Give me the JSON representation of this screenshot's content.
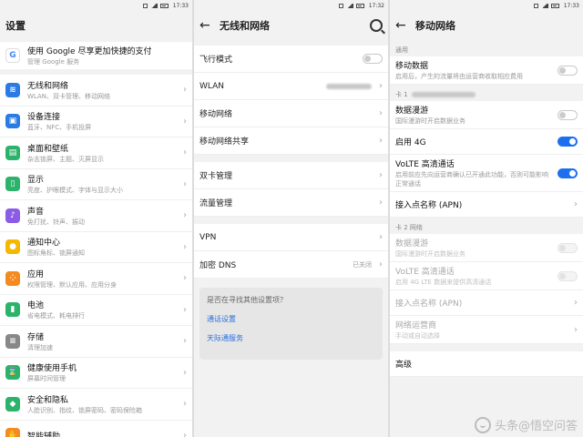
{
  "statusbar": [
    {
      "time": "17:33"
    },
    {
      "time": "17:32"
    },
    {
      "time": "17:33"
    }
  ],
  "settings": {
    "title": "设置",
    "google": {
      "title": "使用 Google 尽享更加快捷的支付",
      "subtitle": "管理 Google 服务"
    },
    "items": [
      {
        "title": "无线和网络",
        "subtitle": "WLAN、双卡管理、移动网络",
        "icon": "wifi-icon",
        "color": "#2b7be5"
      },
      {
        "title": "设备连接",
        "subtitle": "蓝牙、NFC、手机投屏",
        "icon": "device-connect-icon",
        "color": "#2b7be5"
      },
      {
        "title": "桌面和壁纸",
        "subtitle": "杂志锁屏、主题、灭屏显示",
        "icon": "wallpaper-icon",
        "color": "#2cb36b"
      },
      {
        "title": "显示",
        "subtitle": "亮度、护眼模式、字体与显示大小",
        "icon": "display-icon",
        "color": "#2cb36b"
      },
      {
        "title": "声音",
        "subtitle": "免打扰、铃声、振动",
        "icon": "sound-icon",
        "color": "#8b5ce6"
      },
      {
        "title": "通知中心",
        "subtitle": "图标角标、锁屏通知",
        "icon": "notification-icon",
        "color": "#f5b700"
      },
      {
        "title": "应用",
        "subtitle": "权限管理、默认应用、应用分身",
        "icon": "apps-icon",
        "color": "#f58a1f"
      },
      {
        "title": "电池",
        "subtitle": "省电模式、耗电排行",
        "icon": "battery-icon",
        "color": "#2cb36b"
      },
      {
        "title": "存储",
        "subtitle": "清理加速",
        "icon": "storage-icon",
        "color": "#888888"
      },
      {
        "title": "健康使用手机",
        "subtitle": "屏幕时间管理",
        "icon": "health-icon",
        "color": "#2cb36b"
      },
      {
        "title": "安全和隐私",
        "subtitle": "人脸识别、指纹、锁屏密码、密码保险箱",
        "icon": "shield-icon",
        "color": "#2cb36b"
      },
      {
        "title": "智能辅助",
        "subtitle": "",
        "icon": "assist-icon",
        "color": "#f58a1f"
      }
    ]
  },
  "wireless": {
    "title": "无线和网络",
    "group1": [
      {
        "label": "飞行模式"
      },
      {
        "label": "WLAN"
      },
      {
        "label": "移动网络"
      },
      {
        "label": "移动网络共享"
      }
    ],
    "group2": [
      {
        "label": "双卡管理"
      },
      {
        "label": "流量管理"
      }
    ],
    "group3": [
      {
        "label": "VPN"
      },
      {
        "label": "加密 DNS",
        "value": "已关闭"
      }
    ],
    "tips": {
      "question": "是否在寻找其他设置项？",
      "links": [
        "通话设置",
        "天际通服务"
      ]
    }
  },
  "mobile": {
    "title": "移动网络",
    "section_general": "通用",
    "mobile_data": {
      "title": "移动数据",
      "subtitle": "启用后，产生的流量将由运营商收取相应费用"
    },
    "sim1_label": "卡 1",
    "sim1": [
      {
        "title": "数据漫游",
        "subtitle": "国际漫游时开启数据业务",
        "toggle": "off"
      },
      {
        "title": "启用 4G",
        "subtitle": "",
        "toggle": "on"
      },
      {
        "title": "VoLTE 高清通话",
        "subtitle": "启用前应先向运营商确认已开通此功能，否则可能影响正常通话",
        "toggle": "on"
      },
      {
        "title": "接入点名称 (APN)",
        "subtitle": "",
        "toggle": "chevron"
      }
    ],
    "sim2_label": "卡 2 网络",
    "sim2": [
      {
        "title": "数据漫游",
        "subtitle": "国际漫游时开启数据业务",
        "toggle": "disabled"
      },
      {
        "title": "VoLTE 高清通话",
        "subtitle": "启用 4G LTE 数据来提供高清通话",
        "toggle": "disabled"
      },
      {
        "title": "接入点名称 (APN)",
        "subtitle": "",
        "toggle": "chevron"
      },
      {
        "title": "网络运营商",
        "subtitle": "手动或自动选择",
        "toggle": "chevron"
      }
    ],
    "advanced": "高级"
  },
  "watermark": "头条@悟空问答"
}
